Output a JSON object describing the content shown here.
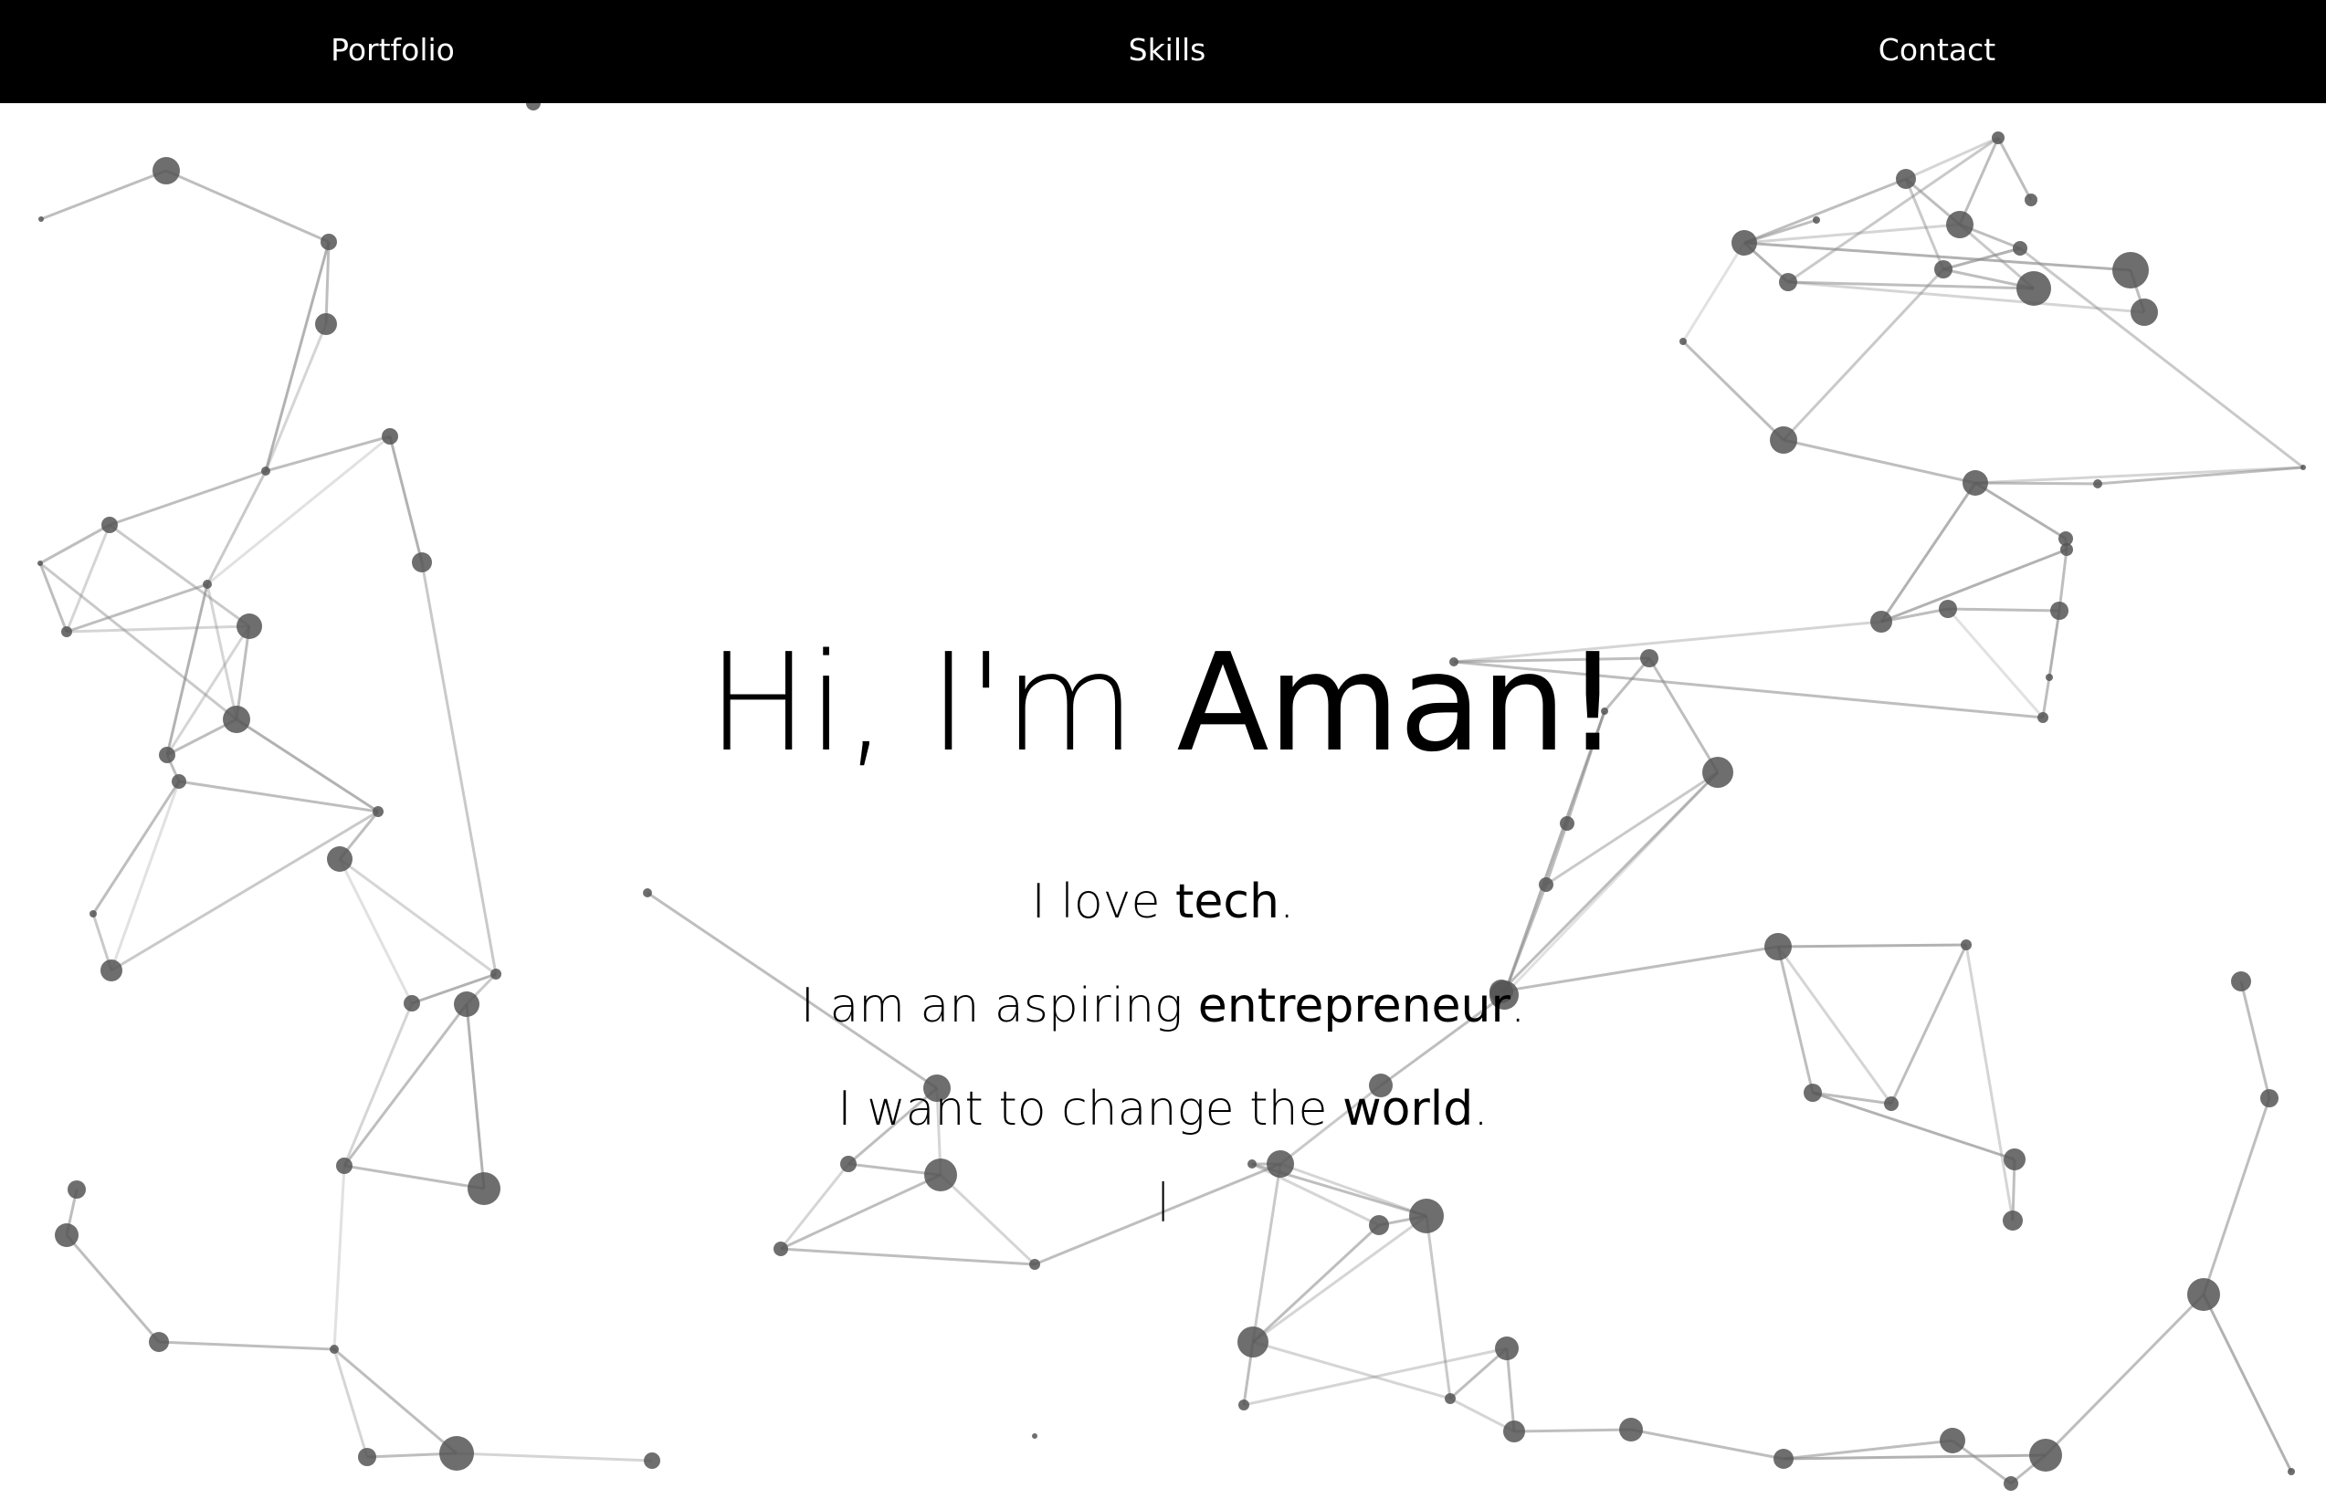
{
  "nav": {
    "items": [
      {
        "label": "Portfolio"
      },
      {
        "label": "Skills"
      },
      {
        "label": "Contact"
      }
    ]
  },
  "hero": {
    "greeting": "Hi, I'm",
    "name": "Aman!",
    "lines": [
      {
        "prefix": "I love",
        "emphasis": "tech",
        "suffix": "."
      },
      {
        "prefix": "I am an aspiring",
        "emphasis": "entrepreneur",
        "suffix": "."
      },
      {
        "prefix": "I want to change the",
        "emphasis": "world",
        "suffix": "."
      }
    ],
    "cursor": "|"
  },
  "colors": {
    "nav_background": "#000000",
    "nav_text": "#ffffff",
    "node": "#555555",
    "edge": "#888888",
    "background": "#ffffff"
  },
  "decoration": {
    "style": "particle-network"
  }
}
